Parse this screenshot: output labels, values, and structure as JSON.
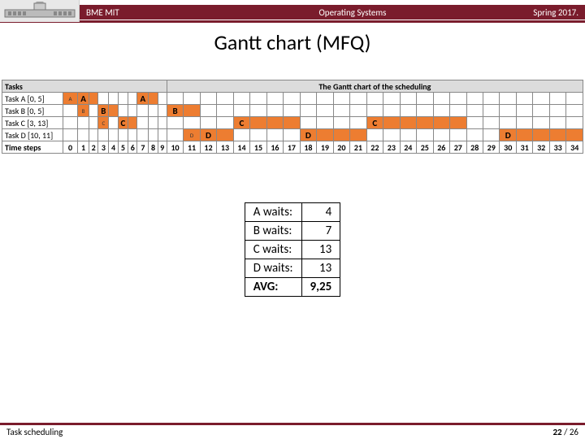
{
  "header": {
    "left": "BME MIT",
    "mid": "Operating Systems",
    "right": "Spring 2017."
  },
  "title": "Gantt chart (MFQ)",
  "gantt": {
    "header_left": "Tasks",
    "header_right": "The Gantt chart of the scheduling",
    "rows": [
      {
        "label": "Task A [0, 5]"
      },
      {
        "label": "Task B [0, 5]"
      },
      {
        "label": "Task C [3, 13]"
      },
      {
        "label": "Task D [10, 11]"
      }
    ],
    "time_label": "Time steps",
    "steps": [
      "0",
      "1",
      "2",
      "3",
      "4",
      "5",
      "6",
      "7",
      "8",
      "9",
      "10",
      "11",
      "12",
      "13",
      "14",
      "15",
      "16",
      "17",
      "18",
      "19",
      "20",
      "21",
      "22",
      "23",
      "24",
      "25",
      "26",
      "27",
      "28",
      "29",
      "30",
      "31",
      "32",
      "33",
      "34"
    ]
  },
  "wait": {
    "rows": [
      {
        "name": "A waits:",
        "val": "4"
      },
      {
        "name": "B waits:",
        "val": "7"
      },
      {
        "name": "C waits:",
        "val": "13"
      },
      {
        "name": "D waits:",
        "val": "13"
      }
    ],
    "avg_label": "AVG:",
    "avg_val": "9,25"
  },
  "footer": {
    "left": "Task scheduling",
    "page_cur": "22",
    "page_sep": " / ",
    "page_tot": "26"
  },
  "chart_data": {
    "type": "bar",
    "title": "Gantt chart (MFQ)",
    "xlabel": "Time steps",
    "x": [
      0,
      1,
      2,
      3,
      4,
      5,
      6,
      7,
      8,
      9,
      10,
      11,
      12,
      13,
      14,
      15,
      16,
      17,
      18,
      19,
      20,
      21,
      22,
      23,
      24,
      25,
      26,
      27,
      28,
      29,
      30,
      31,
      32,
      33,
      34
    ],
    "series": [
      {
        "name": "Task A [0, 5]",
        "segments": [
          [
            0,
            1
          ],
          [
            1,
            3
          ],
          [
            7,
            9
          ]
        ]
      },
      {
        "name": "Task B [0, 5]",
        "segments": [
          [
            1,
            2
          ],
          [
            3,
            5
          ],
          [
            10,
            12
          ]
        ]
      },
      {
        "name": "Task C [3, 13]",
        "segments": [
          [
            3,
            4
          ],
          [
            5,
            7
          ],
          [
            14,
            18
          ],
          [
            22,
            28
          ]
        ]
      },
      {
        "name": "Task D [10, 11]",
        "segments": [
          [
            11,
            12
          ],
          [
            12,
            14
          ],
          [
            18,
            22
          ],
          [
            30,
            34
          ]
        ]
      }
    ],
    "wait_times": {
      "A": 4,
      "B": 7,
      "C": 13,
      "D": 13,
      "avg": 9.25
    }
  }
}
